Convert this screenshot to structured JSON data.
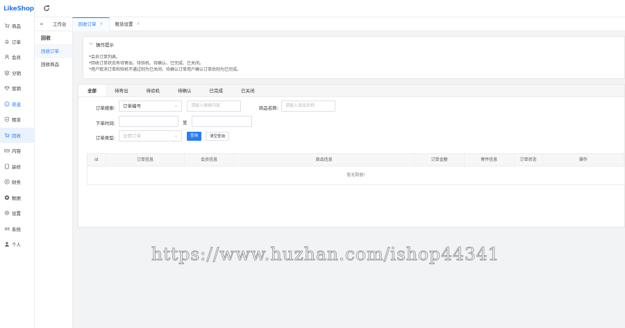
{
  "app": {
    "logo": "LikeShop"
  },
  "sidebar": {
    "items": [
      {
        "label": "商品",
        "icon": "cart-icon"
      },
      {
        "label": "订单",
        "icon": "bell-icon"
      },
      {
        "label": "会员",
        "icon": "user-icon"
      },
      {
        "label": "分销",
        "icon": "layers-icon"
      },
      {
        "label": "营销",
        "icon": "diamond-icon"
      },
      {
        "label": "渠道",
        "icon": "info-icon"
      },
      {
        "label": "租赁",
        "icon": "shield-icon"
      },
      {
        "label": "回收",
        "icon": "cart-icon"
      },
      {
        "label": "内容",
        "icon": "crown-icon"
      },
      {
        "label": "装修",
        "icon": "tablet-icon"
      },
      {
        "label": "财务",
        "icon": "coin-icon"
      },
      {
        "label": "数据",
        "icon": "data-icon"
      },
      {
        "label": "设置",
        "icon": "gear-icon"
      },
      {
        "label": "系统",
        "icon": "system-icon"
      },
      {
        "label": "个人",
        "icon": "person-icon"
      }
    ]
  },
  "submenu": {
    "title": "回收",
    "items": [
      "回收订单",
      "回收商品"
    ]
  },
  "tabs": [
    {
      "label": "工作台"
    },
    {
      "label": "回收订单"
    },
    {
      "label": "租赁设置"
    }
  ],
  "tips": {
    "title": "操作提示",
    "lines": [
      "*会员订单列表。",
      "*回收订单状态有待寄出、待验机、待确认、已完成、已关闭。",
      "*用户取消订单和验机不通过则为已关闭、待确认订单用户确认订单后则为已完成。"
    ]
  },
  "status_tabs": [
    "全部",
    "待寄出",
    "待验机",
    "待确认",
    "已完成",
    "已关闭"
  ],
  "form": {
    "search_label": "订单搜索:",
    "search_type": "订单编号",
    "search_placeholder": "请输入搜索内容",
    "goods_label": "商品名称:",
    "goods_placeholder": "请输入商品名称",
    "time_label": "下单时间:",
    "time_sep": "至",
    "type_label": "订单类型:",
    "type_placeholder": "全部订单",
    "query_button": "查询",
    "clear_button": "清空查询"
  },
  "table": {
    "columns": [
      "id",
      "订单信息",
      "会员信息",
      "商品信息",
      "订单金额",
      "寄件信息",
      "订单状态",
      "操作"
    ],
    "empty_text": "暂无数据!"
  },
  "watermark": "https://www.huzhan.com/ishop44341",
  "colors": {
    "accent": "#2a7cf6"
  }
}
